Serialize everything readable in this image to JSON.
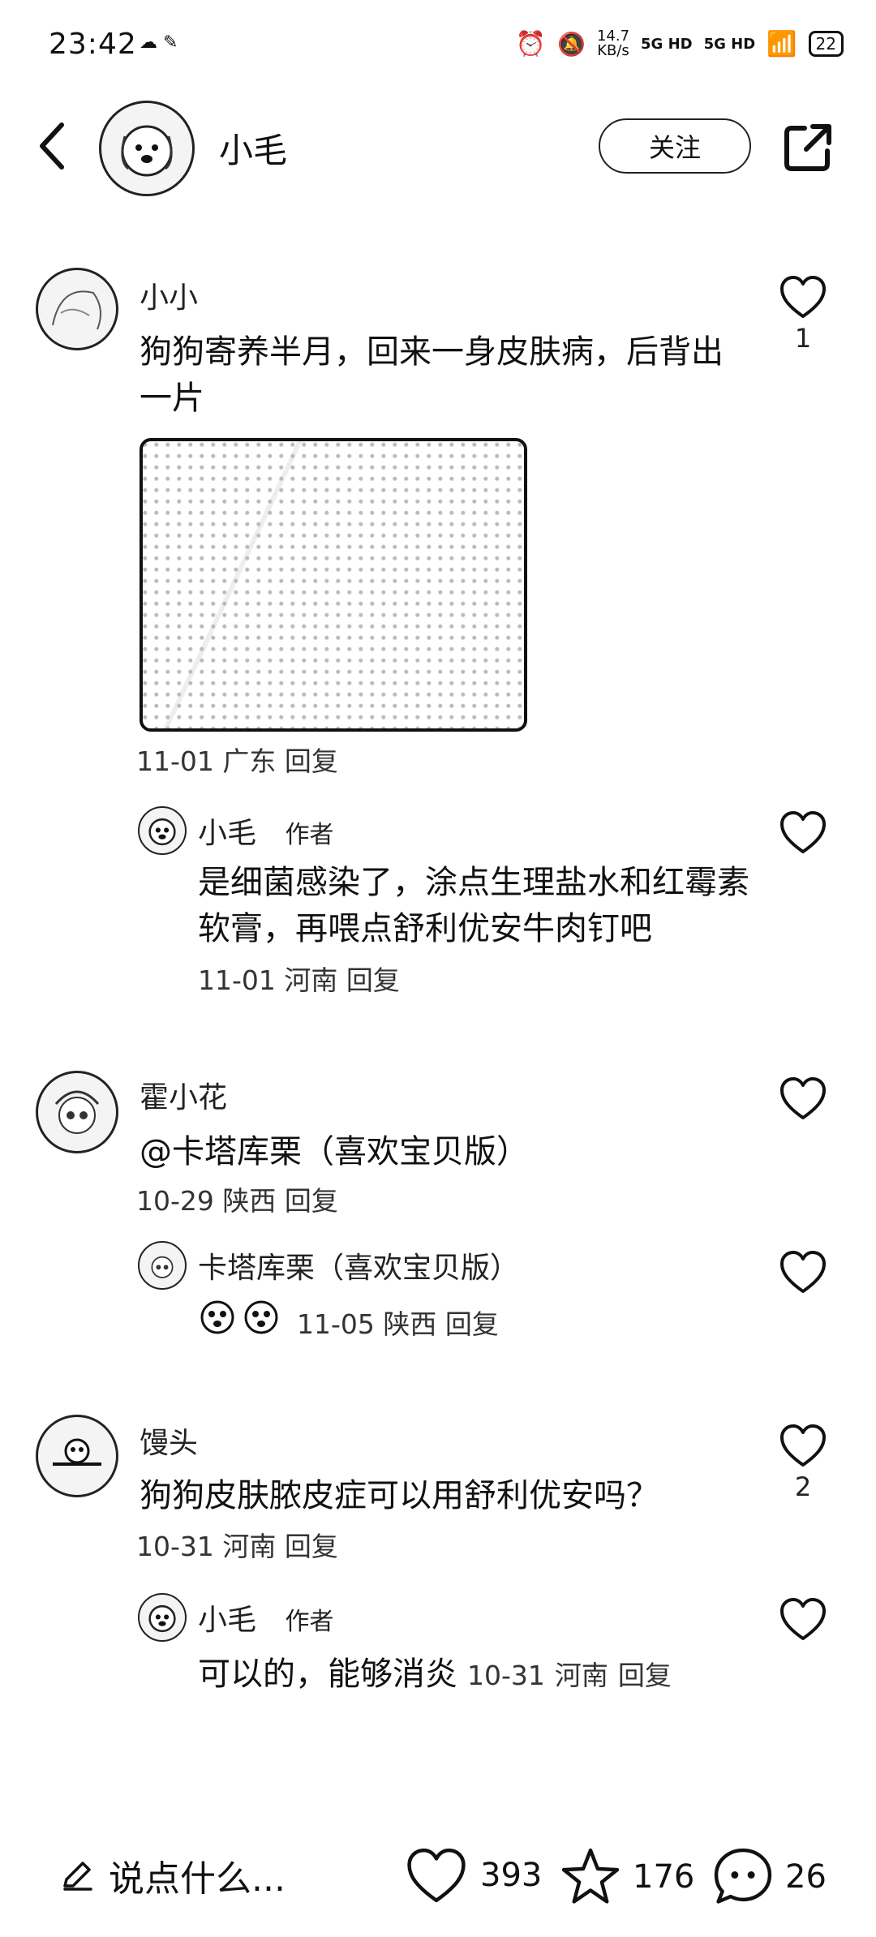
{
  "status_bar": {
    "time": "23:42",
    "net_speed": "14.7",
    "net_unit": "KB/s",
    "sim1": "5G HD",
    "sim2": "5G HD",
    "battery": "22"
  },
  "header": {
    "title": "小毛",
    "follow_label": "关注"
  },
  "comments": [
    {
      "user": "小小",
      "text": "狗狗寄养半月，回来一身皮肤病，后背出一片",
      "meta_date": "11-01",
      "meta_loc": "广东",
      "reply": "回复",
      "likes": "1",
      "reply_item": {
        "user": "小毛",
        "tag": "作者",
        "text": "是细菌感染了，涂点生理盐水和红霉素软膏，再喂点舒利优安牛肉钉吧",
        "meta_date": "11-01",
        "meta_loc": "河南",
        "reply": "回复"
      }
    },
    {
      "user": "霍小花",
      "text": "@卡塔库栗（喜欢宝贝版）",
      "meta_date": "10-29",
      "meta_loc": "陕西",
      "reply": "回复",
      "reply_item": {
        "user": "卡塔库栗（喜欢宝贝版）",
        "meta_date": "11-05",
        "meta_loc": "陕西",
        "reply": "回复"
      }
    },
    {
      "user": "馒头",
      "text": "狗狗皮肤脓皮症可以用舒利优安吗？",
      "meta_date": "10-31",
      "meta_loc": "河南",
      "reply": "回复",
      "likes": "2",
      "reply_item": {
        "user": "小毛",
        "tag": "作者",
        "text": "可以的，能够消炎",
        "meta_date": "10-31",
        "meta_loc": "河南",
        "reply": "回复"
      }
    }
  ],
  "bottom_bar": {
    "placeholder": "说点什么...",
    "likes": "393",
    "favorites": "176",
    "comments": "26"
  },
  "icons": [
    "back-icon",
    "share-icon",
    "heart-icon",
    "star-icon",
    "comment-icon",
    "pencil-icon",
    "alarm-icon",
    "mute-icon",
    "wifi-icon"
  ]
}
